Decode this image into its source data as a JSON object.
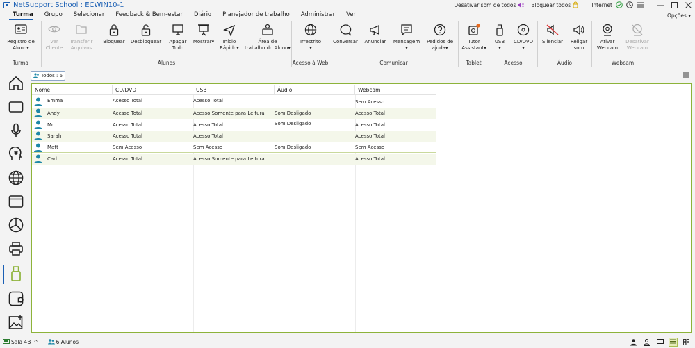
{
  "window": {
    "title": "NetSupport School : ECWIN10-1",
    "sound_toggle": "Desativar som de todos",
    "lock_all": "Bloquear todos",
    "internet": "Internet",
    "options": "Opções"
  },
  "menu": [
    "Turma",
    "Grupo",
    "Selecionar",
    "Feedback & Bem-estar",
    "Diário",
    "Planejador de trabalho",
    "Administrar",
    "Ver"
  ],
  "ribbon": {
    "registro_line1": "Registro de",
    "registro_line2": "Aluno",
    "ver_line1": "Ver",
    "ver_line2": "Cliente",
    "transferir_line1": "Transferir",
    "transferir_line2": "Arquivos",
    "bloquear": "Bloquear",
    "desbloquear": "Desbloquear",
    "apagar_line1": "Apagar",
    "apagar_line2": "Tudo",
    "mostrar": "Mostrar",
    "inicio_line1": "Início",
    "inicio_line2": "Rápido",
    "area_line1": "Área de",
    "area_line2": "trabalho do Aluno",
    "irrestrito": "Irrestrito",
    "conversar": "Conversar",
    "anunciar": "Anunciar",
    "mensagem": "Mensagem",
    "pedidos_line1": "Pedidos de",
    "pedidos_line2": "ajuda",
    "tutor_line1": "Tutor",
    "tutor_line2": "Assistant",
    "usb": "USB",
    "cddvd": "CD/DVD",
    "silenciar": "Silenciar",
    "religar_line1": "Religar",
    "religar_line2": "som",
    "ativar_line1": "Ativar",
    "ativar_line2": "Webcam",
    "desativar_line1": "Desativar",
    "desativar_line2": "Webcam",
    "groups": {
      "turma": "Turma",
      "alunos": "Alunos",
      "acesso_web": "Acesso à Web",
      "comunicar": "Comunicar",
      "tablet": "Tablet",
      "acesso": "Acesso",
      "audio": "Áudio",
      "webcam": "Webcam"
    }
  },
  "filter": {
    "label": "Todos : 6"
  },
  "table": {
    "columns": [
      "Nome",
      "CD/DVD",
      "USB",
      "Áudio",
      "Webcam"
    ],
    "rows": [
      {
        "name": "Emma",
        "cddvd": "Acesso Total",
        "usb": "Acesso Total",
        "audio": "",
        "webcam": "Sem Acesso"
      },
      {
        "name": "Andy",
        "cddvd": "Acesso Total",
        "usb": "Acesso Somente para Leitura",
        "audio": "Som Desligado",
        "webcam": "Acesso Total"
      },
      {
        "name": "Mo",
        "cddvd": "Acesso Total",
        "usb": "Acesso Total",
        "audio": "Som Desligado",
        "webcam": "Acesso Total"
      },
      {
        "name": "Sarah",
        "cddvd": "Acesso Total",
        "usb": "Acesso Total",
        "audio": "",
        "webcam": "Acesso Total"
      },
      {
        "name": "Matt",
        "cddvd": "Sem Acesso",
        "usb": "Sem Acesso",
        "audio": "Som Desligado",
        "webcam": "Sem Acesso"
      },
      {
        "name": "Carl",
        "cddvd": "Acesso Total",
        "usb": "Acesso Somente para Leitura",
        "audio": "",
        "webcam": "Acesso Total"
      }
    ]
  },
  "status": {
    "room": "Sala 4B",
    "students": "6 Alunos"
  },
  "colors": {
    "accent": "#1a5fb4",
    "frame": "#8db33a",
    "row_alt": "#f4f7ea",
    "student_icon": "#1e88a8"
  }
}
